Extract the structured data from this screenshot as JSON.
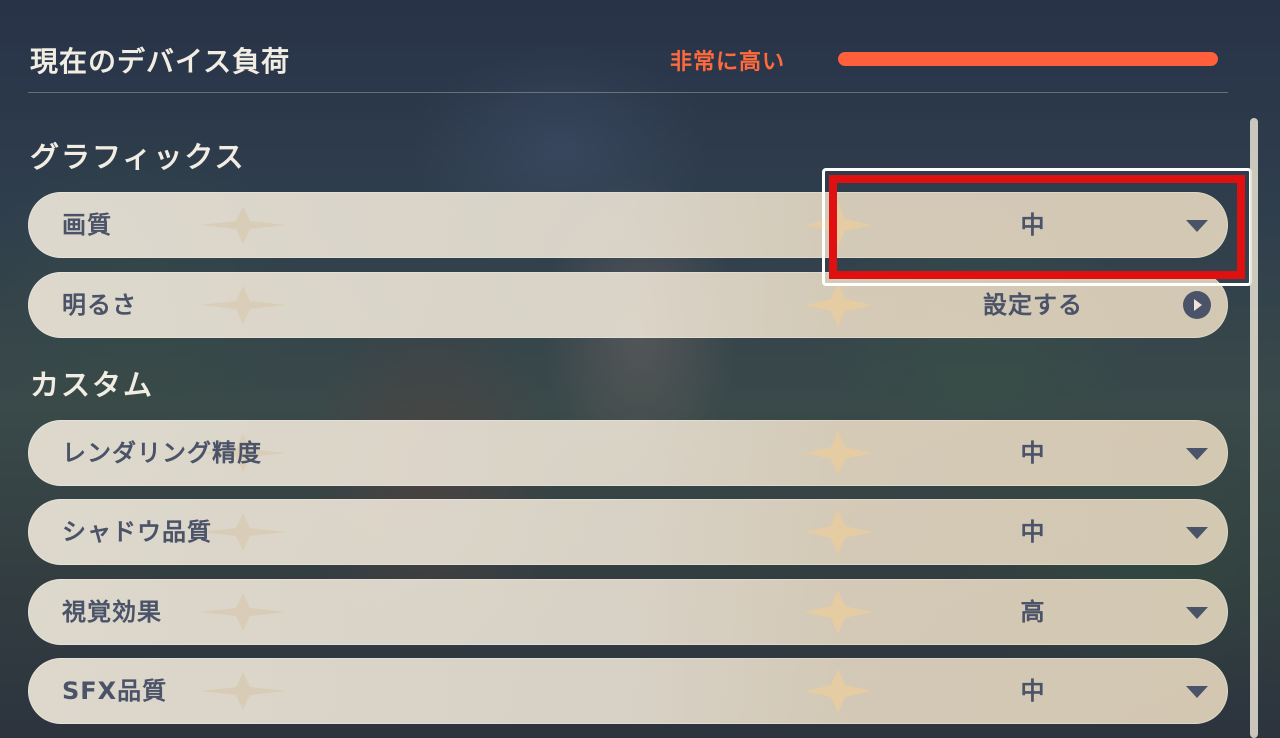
{
  "header": {
    "device_load_label": "現在のデバイス負荷",
    "device_load_value": "非常に高い",
    "device_load_level": 1.0
  },
  "sections": {
    "graphics_title": "グラフィックス",
    "custom_title": "カスタム"
  },
  "graphics": {
    "quality": {
      "label": "画質",
      "value": "中"
    },
    "brightness": {
      "label": "明るさ",
      "value": "設定する"
    }
  },
  "custom": {
    "render_resolution": {
      "label": "レンダリング精度",
      "value": "中"
    },
    "shadow_quality": {
      "label": "シャドウ品質",
      "value": "中"
    },
    "visual_effects": {
      "label": "視覚効果",
      "value": "高"
    },
    "sfx_quality": {
      "label": "SFX品質",
      "value": "中"
    }
  },
  "colors": {
    "load_warning": "#ff5f3a",
    "highlight": "#e01010",
    "row_text": "#4b5368"
  },
  "icons": {
    "dropdown": "chevron-down-icon",
    "go": "play-circle-icon",
    "ornament": "sparkle-icon"
  }
}
